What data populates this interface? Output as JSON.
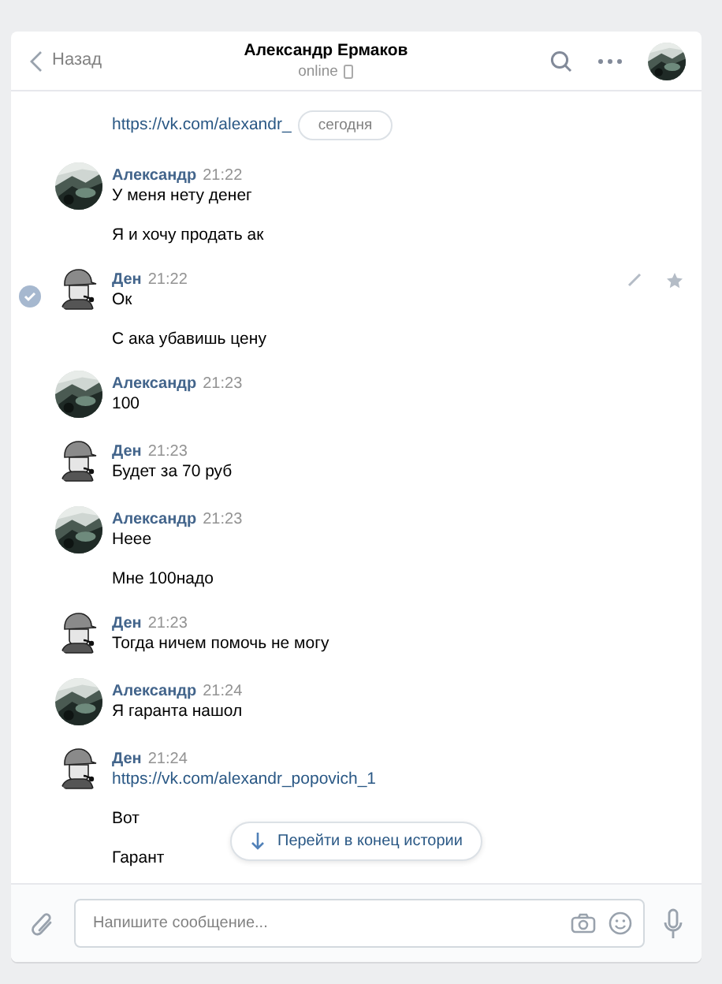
{
  "header": {
    "back": "Назад",
    "title": "Александр Ермаков",
    "status": "online"
  },
  "date_pill": "сегодня",
  "top_link": "https://vk.com/alexandr_",
  "messages": [
    {
      "author": "Александр",
      "time": "21:22",
      "selected": false,
      "lines": [
        {
          "kind": "text",
          "text": "У меня нету денег"
        },
        {
          "kind": "text",
          "text": "Я и хочу продать ак"
        }
      ]
    },
    {
      "author": "Ден",
      "time": "21:22",
      "kind": "hat",
      "selected": true,
      "lines": [
        {
          "kind": "text",
          "text": "Ок"
        },
        {
          "kind": "text",
          "text": "С ака убавишь цену"
        }
      ]
    },
    {
      "author": "Александр",
      "time": "21:23",
      "selected": false,
      "lines": [
        {
          "kind": "text",
          "text": "100"
        }
      ]
    },
    {
      "author": "Ден",
      "time": "21:23",
      "kind": "hat",
      "selected": false,
      "lines": [
        {
          "kind": "text",
          "text": "Будет за 70 руб"
        }
      ]
    },
    {
      "author": "Александр",
      "time": "21:23",
      "selected": false,
      "lines": [
        {
          "kind": "text",
          "text": "Неее"
        },
        {
          "kind": "text",
          "text": "Мне 100надо"
        }
      ]
    },
    {
      "author": "Ден",
      "time": "21:23",
      "kind": "hat",
      "selected": false,
      "lines": [
        {
          "kind": "text",
          "text": "Тогда ничем помочь не могу"
        }
      ]
    },
    {
      "author": "Александр",
      "time": "21:24",
      "selected": false,
      "lines": [
        {
          "kind": "text",
          "text": "Я гаранта нашол"
        }
      ]
    },
    {
      "author": "Ден",
      "time": "21:24",
      "kind": "hat",
      "selected": false,
      "lines": [
        {
          "kind": "link",
          "text": "https://vk.com/alexandr_popovich_1"
        },
        {
          "kind": "text",
          "text": "Вот"
        },
        {
          "kind": "text",
          "text": "Гарант"
        }
      ]
    }
  ],
  "jump_button": "Перейти в конец истории",
  "composer": {
    "placeholder": "Напишите сообщение..."
  }
}
